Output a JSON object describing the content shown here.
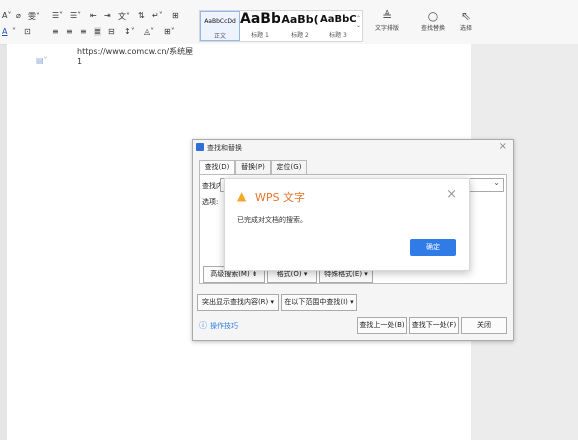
{
  "ribbon": {
    "styles": [
      {
        "sample": "AaBbCcDd",
        "name": "正文"
      },
      {
        "sample": "AaBb",
        "name": "标题 1"
      },
      {
        "sample": "AaBb(",
        "name": "标题 2"
      },
      {
        "sample": "AaBbC",
        "name": "标题 3"
      }
    ],
    "text_layout_label": "文字排版",
    "find_replace_label": "查找替换",
    "select_label": "选择"
  },
  "document": {
    "url_line": "https://www.comcw.cn/系统屋",
    "line2": "1"
  },
  "find_dialog": {
    "title": "查找和替换",
    "tabs": [
      "查找(D)",
      "替换(P)",
      "定位(G)"
    ],
    "find_label": "查找内",
    "options_label": "选项:",
    "advanced_search": "高级搜索(M) ⇟",
    "format": "格式(O) ▾",
    "special_format": "特殊格式(E) ▾",
    "highlight": "突出显示查找内容(R) ▾",
    "find_in": "在以下范围中查找(I) ▾",
    "tips": "操作技巧",
    "find_prev": "查找上一处(B)",
    "find_next": "查找下一处(F)",
    "close": "关闭"
  },
  "message": {
    "title": "WPS 文字",
    "text": "已完成对文档的搜索。",
    "ok": "确定"
  },
  "colors": {
    "accent": "#2f7ce6",
    "warning": "#f5a623",
    "wps_title": "#e8732a"
  }
}
